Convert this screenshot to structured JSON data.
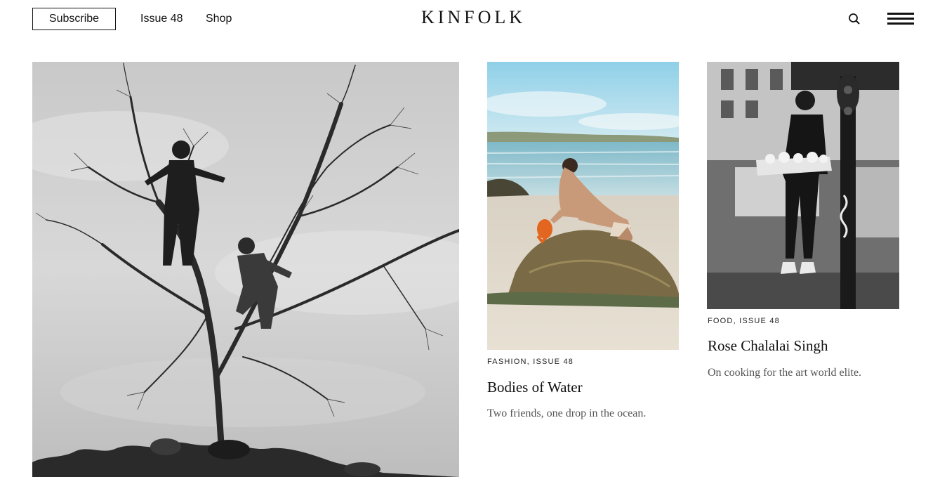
{
  "header": {
    "subscribe_label": "Subscribe",
    "nav": [
      {
        "label": "Issue 48"
      },
      {
        "label": "Shop"
      }
    ],
    "logo": "KINFOLK",
    "search_icon": "search-icon",
    "menu_icon": "hamburger-menu-icon"
  },
  "articles": [
    {
      "category": "FASHION, ISSUE 48",
      "title": "Bodies of Water",
      "description": "Two friends, one drop in the ocean."
    },
    {
      "category": "FOOD, ISSUE 48",
      "title": "Rose Chalalai Singh",
      "description": "On cooking for the art world elite."
    }
  ]
}
